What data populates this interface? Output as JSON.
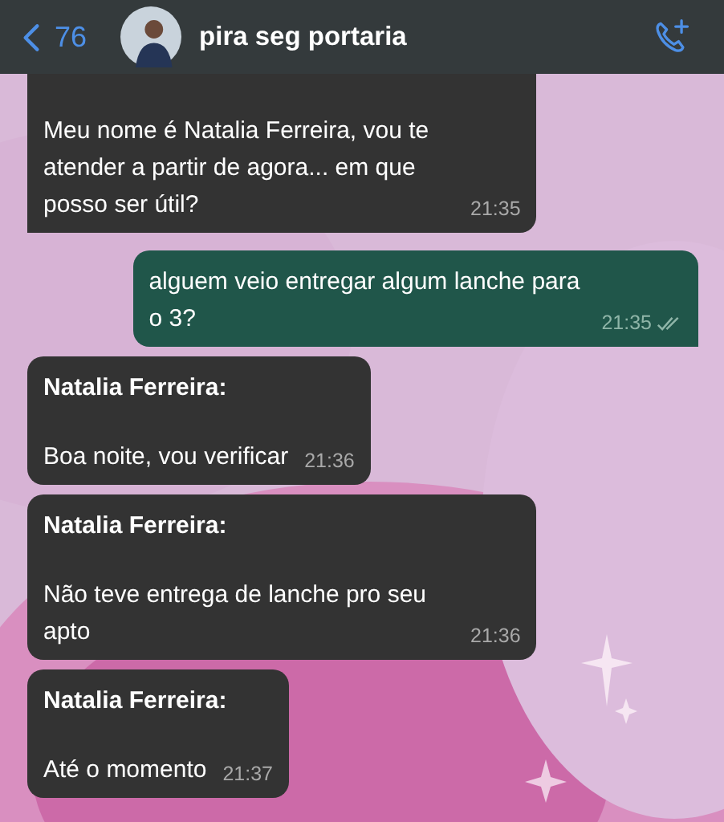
{
  "header": {
    "back_count": "76",
    "contact_name": "pira seg portaria"
  },
  "messages": [
    {
      "kind": "incoming",
      "text": "Meu nome é Natalia Ferreira, vou te atender a partir de agora... em que posso ser útil?",
      "time": "21:35",
      "tail": true
    },
    {
      "kind": "outgoing",
      "text": "alguem veio entregar algum lanche para o 3?",
      "time": "21:35",
      "tail": true,
      "read": true
    },
    {
      "kind": "incoming",
      "sender": "Natalia Ferreira:",
      "text": "Boa noite, vou verificar",
      "time": "21:36",
      "tail": false
    },
    {
      "kind": "incoming",
      "sender": "Natalia Ferreira:",
      "text": "Não teve entrega de lanche pro seu apto",
      "time": "21:36",
      "tail": false
    },
    {
      "kind": "incoming",
      "sender": "Natalia Ferreira:",
      "text": "Até o momento",
      "time": "21:37"
    }
  ]
}
